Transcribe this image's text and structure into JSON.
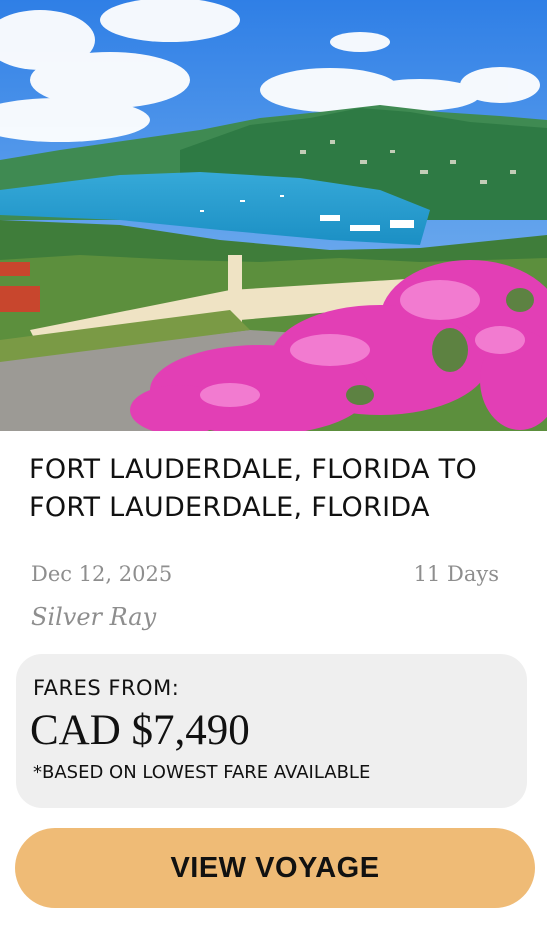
{
  "colors": {
    "title_text": "#111111",
    "meta_text": "#8e8e8e",
    "fare_box_bg": "#efefef",
    "cta_bg": "#efbb76",
    "cta_text": "#111111"
  },
  "hero": {
    "image": "coastal-harbor-photo"
  },
  "voyage": {
    "title": "FORT LAUDERDALE, FLORIDA TO FORT LAUDERDALE, FLORIDA",
    "date": "Dec 12, 2025",
    "duration": "11 Days",
    "ship": "Silver Ray"
  },
  "fare": {
    "label": "FARES FROM:",
    "price": "CAD $7,490",
    "note": "*BASED ON LOWEST FARE AVAILABLE"
  },
  "cta": {
    "label": "VIEW VOYAGE"
  }
}
